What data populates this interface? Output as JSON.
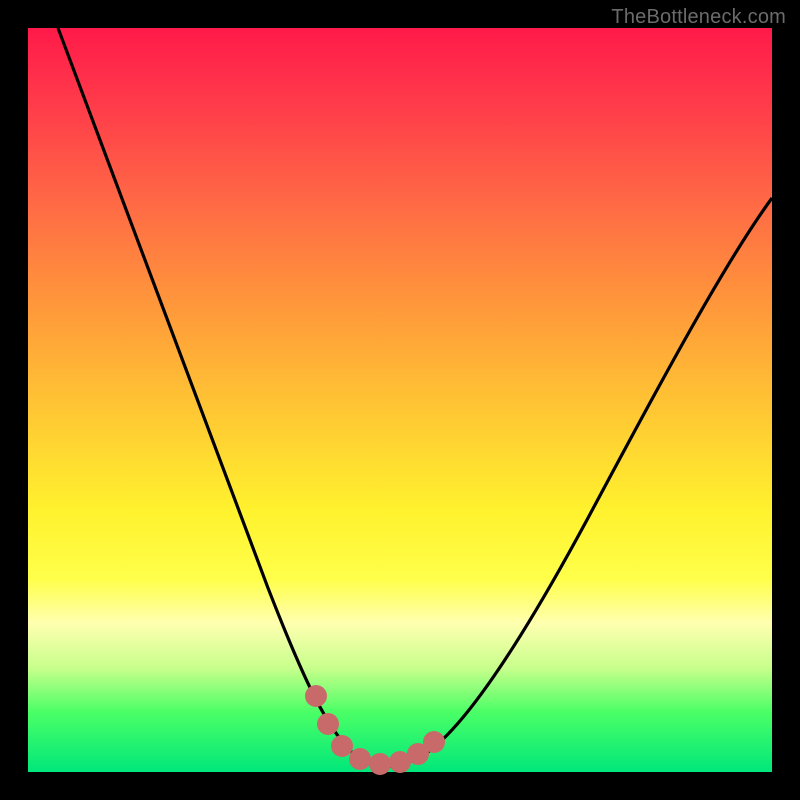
{
  "watermark": "TheBottleneck.com",
  "chart_data": {
    "type": "line",
    "title": "",
    "xlabel": "",
    "ylabel": "",
    "xlim": [
      0,
      100
    ],
    "ylim": [
      0,
      100
    ],
    "series": [
      {
        "name": "bottleneck-curve",
        "x": [
          2,
          10,
          18,
          24,
          30,
          34,
          38,
          40,
          43,
          45,
          47,
          49,
          52,
          56,
          62,
          70,
          80,
          90,
          100
        ],
        "values": [
          100,
          80,
          60,
          46,
          32,
          22,
          12,
          7,
          2,
          1,
          1,
          2,
          5,
          12,
          22,
          35,
          50,
          64,
          78
        ]
      }
    ],
    "markers": {
      "name": "highlight-dots",
      "color": "#c96a6a",
      "x": [
        38,
        40,
        42,
        44,
        46,
        48,
        50,
        52
      ],
      "values": [
        10,
        5,
        2,
        1,
        1,
        2,
        3,
        6
      ]
    },
    "background_gradient": {
      "top": "#ff1a49",
      "mid": "#fff22e",
      "bottom": "#00e77a"
    }
  }
}
